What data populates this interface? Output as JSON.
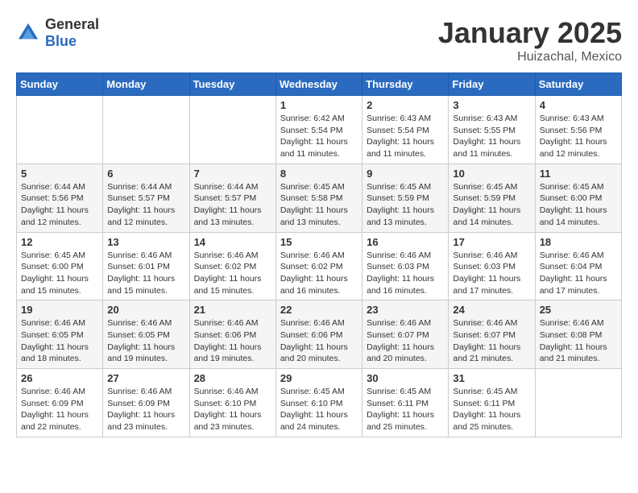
{
  "logo": {
    "text_general": "General",
    "text_blue": "Blue"
  },
  "title": {
    "month": "January 2025",
    "location": "Huizachal, Mexico"
  },
  "weekdays": [
    "Sunday",
    "Monday",
    "Tuesday",
    "Wednesday",
    "Thursday",
    "Friday",
    "Saturday"
  ],
  "weeks": [
    [
      {
        "day": "",
        "info": ""
      },
      {
        "day": "",
        "info": ""
      },
      {
        "day": "",
        "info": ""
      },
      {
        "day": "1",
        "info": "Sunrise: 6:42 AM\nSunset: 5:54 PM\nDaylight: 11 hours and 11 minutes."
      },
      {
        "day": "2",
        "info": "Sunrise: 6:43 AM\nSunset: 5:54 PM\nDaylight: 11 hours and 11 minutes."
      },
      {
        "day": "3",
        "info": "Sunrise: 6:43 AM\nSunset: 5:55 PM\nDaylight: 11 hours and 11 minutes."
      },
      {
        "day": "4",
        "info": "Sunrise: 6:43 AM\nSunset: 5:56 PM\nDaylight: 11 hours and 12 minutes."
      }
    ],
    [
      {
        "day": "5",
        "info": "Sunrise: 6:44 AM\nSunset: 5:56 PM\nDaylight: 11 hours and 12 minutes."
      },
      {
        "day": "6",
        "info": "Sunrise: 6:44 AM\nSunset: 5:57 PM\nDaylight: 11 hours and 12 minutes."
      },
      {
        "day": "7",
        "info": "Sunrise: 6:44 AM\nSunset: 5:57 PM\nDaylight: 11 hours and 13 minutes."
      },
      {
        "day": "8",
        "info": "Sunrise: 6:45 AM\nSunset: 5:58 PM\nDaylight: 11 hours and 13 minutes."
      },
      {
        "day": "9",
        "info": "Sunrise: 6:45 AM\nSunset: 5:59 PM\nDaylight: 11 hours and 13 minutes."
      },
      {
        "day": "10",
        "info": "Sunrise: 6:45 AM\nSunset: 5:59 PM\nDaylight: 11 hours and 14 minutes."
      },
      {
        "day": "11",
        "info": "Sunrise: 6:45 AM\nSunset: 6:00 PM\nDaylight: 11 hours and 14 minutes."
      }
    ],
    [
      {
        "day": "12",
        "info": "Sunrise: 6:45 AM\nSunset: 6:00 PM\nDaylight: 11 hours and 15 minutes."
      },
      {
        "day": "13",
        "info": "Sunrise: 6:46 AM\nSunset: 6:01 PM\nDaylight: 11 hours and 15 minutes."
      },
      {
        "day": "14",
        "info": "Sunrise: 6:46 AM\nSunset: 6:02 PM\nDaylight: 11 hours and 15 minutes."
      },
      {
        "day": "15",
        "info": "Sunrise: 6:46 AM\nSunset: 6:02 PM\nDaylight: 11 hours and 16 minutes."
      },
      {
        "day": "16",
        "info": "Sunrise: 6:46 AM\nSunset: 6:03 PM\nDaylight: 11 hours and 16 minutes."
      },
      {
        "day": "17",
        "info": "Sunrise: 6:46 AM\nSunset: 6:03 PM\nDaylight: 11 hours and 17 minutes."
      },
      {
        "day": "18",
        "info": "Sunrise: 6:46 AM\nSunset: 6:04 PM\nDaylight: 11 hours and 17 minutes."
      }
    ],
    [
      {
        "day": "19",
        "info": "Sunrise: 6:46 AM\nSunset: 6:05 PM\nDaylight: 11 hours and 18 minutes."
      },
      {
        "day": "20",
        "info": "Sunrise: 6:46 AM\nSunset: 6:05 PM\nDaylight: 11 hours and 19 minutes."
      },
      {
        "day": "21",
        "info": "Sunrise: 6:46 AM\nSunset: 6:06 PM\nDaylight: 11 hours and 19 minutes."
      },
      {
        "day": "22",
        "info": "Sunrise: 6:46 AM\nSunset: 6:06 PM\nDaylight: 11 hours and 20 minutes."
      },
      {
        "day": "23",
        "info": "Sunrise: 6:46 AM\nSunset: 6:07 PM\nDaylight: 11 hours and 20 minutes."
      },
      {
        "day": "24",
        "info": "Sunrise: 6:46 AM\nSunset: 6:07 PM\nDaylight: 11 hours and 21 minutes."
      },
      {
        "day": "25",
        "info": "Sunrise: 6:46 AM\nSunset: 6:08 PM\nDaylight: 11 hours and 21 minutes."
      }
    ],
    [
      {
        "day": "26",
        "info": "Sunrise: 6:46 AM\nSunset: 6:09 PM\nDaylight: 11 hours and 22 minutes."
      },
      {
        "day": "27",
        "info": "Sunrise: 6:46 AM\nSunset: 6:09 PM\nDaylight: 11 hours and 23 minutes."
      },
      {
        "day": "28",
        "info": "Sunrise: 6:46 AM\nSunset: 6:10 PM\nDaylight: 11 hours and 23 minutes."
      },
      {
        "day": "29",
        "info": "Sunrise: 6:45 AM\nSunset: 6:10 PM\nDaylight: 11 hours and 24 minutes."
      },
      {
        "day": "30",
        "info": "Sunrise: 6:45 AM\nSunset: 6:11 PM\nDaylight: 11 hours and 25 minutes."
      },
      {
        "day": "31",
        "info": "Sunrise: 6:45 AM\nSunset: 6:11 PM\nDaylight: 11 hours and 25 minutes."
      },
      {
        "day": "",
        "info": ""
      }
    ]
  ]
}
